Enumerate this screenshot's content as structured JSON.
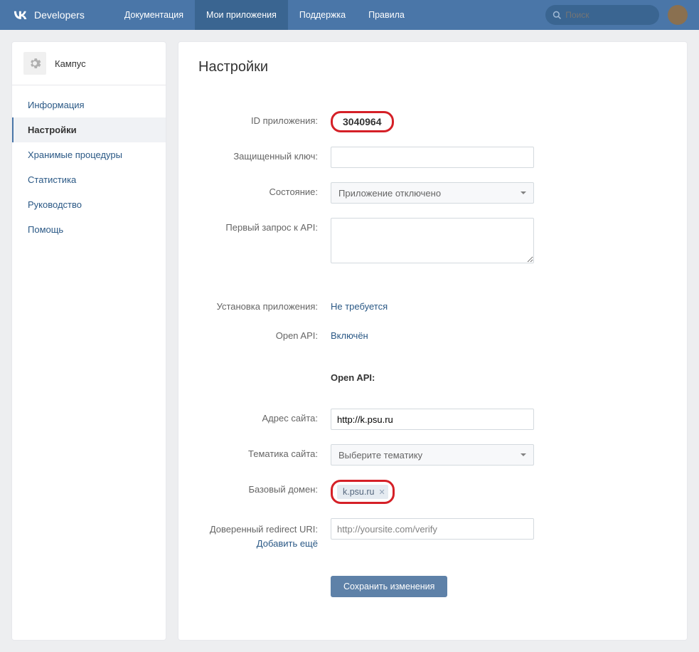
{
  "header": {
    "logo_text": "Developers",
    "nav": [
      "Документация",
      "Мои приложения",
      "Поддержка",
      "Правила"
    ],
    "active_nav_index": 1,
    "search_placeholder": "Поиск"
  },
  "sidebar": {
    "app_name": "Кампус",
    "items": [
      "Информация",
      "Настройки",
      "Хранимые процедуры",
      "Статистика",
      "Руководство",
      "Помощь"
    ],
    "active_index": 1
  },
  "main": {
    "title": "Настройки",
    "fields": {
      "app_id_label": "ID приложения:",
      "app_id_value": "3040964",
      "secret_label": "Защищенный ключ:",
      "secret_value": "",
      "status_label": "Состояние:",
      "status_value": "Приложение отключено",
      "first_request_label": "Первый запрос к API:",
      "first_request_value": "",
      "install_label": "Установка приложения:",
      "install_value": "Не требуется",
      "openapi_label": "Open API:",
      "openapi_value": "Включён",
      "section_header": "Open API:",
      "site_address_label": "Адрес сайта:",
      "site_address_value": "http://k.psu.ru",
      "site_theme_label": "Тематика сайта:",
      "site_theme_placeholder": "Выберите тематику",
      "base_domain_label": "Базовый домен:",
      "base_domain_token": "k.psu.ru",
      "redirect_label_line1": "Доверенный redirect URI:",
      "redirect_label_line2": "Добавить ещё",
      "redirect_placeholder": "http://yoursite.com/verify",
      "save_button": "Сохранить изменения"
    }
  }
}
